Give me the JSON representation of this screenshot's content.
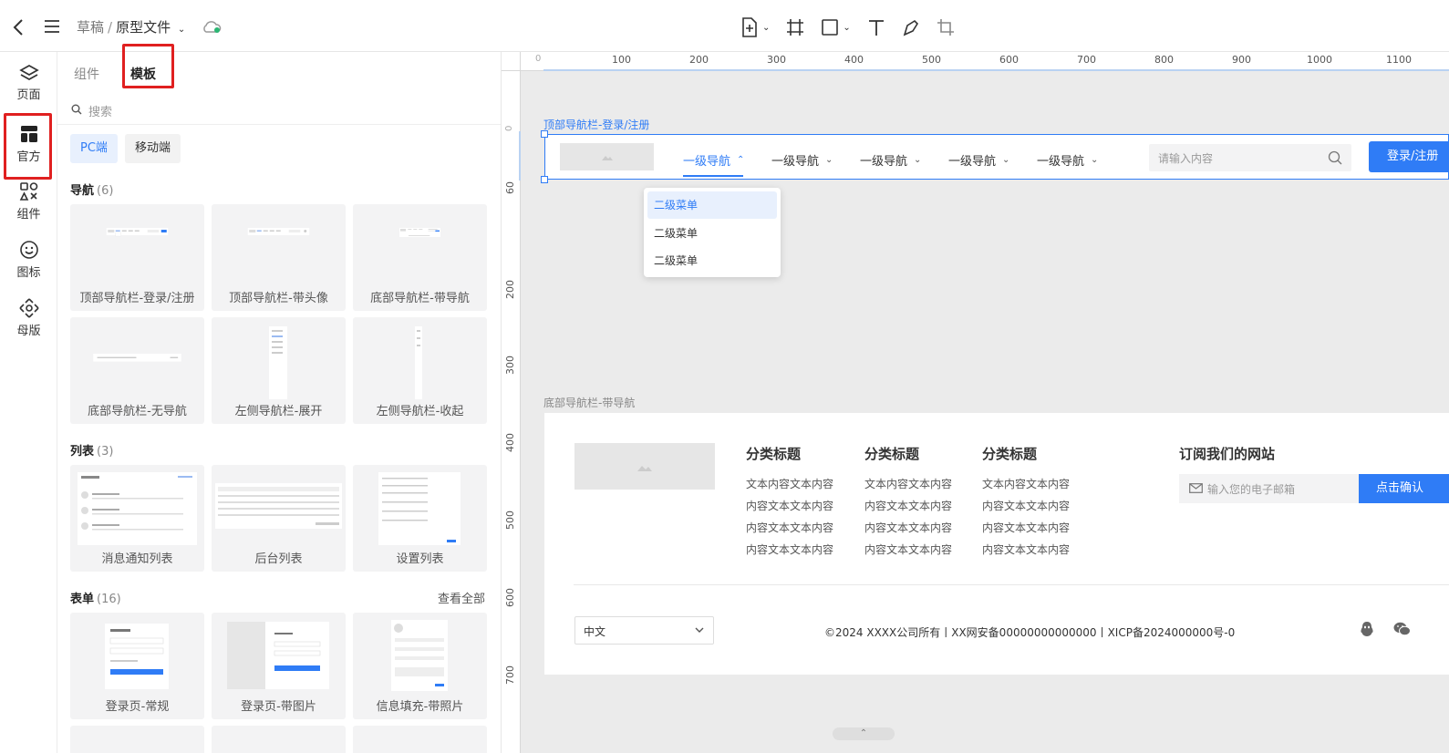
{
  "header": {
    "breadcrumb_root": "草稿",
    "breadcrumb_sep": "/",
    "breadcrumb_current": "原型文件"
  },
  "sidebar": {
    "items": [
      {
        "label": "页面",
        "icon": "layers-icon"
      },
      {
        "label": "官方",
        "icon": "template-icon"
      },
      {
        "label": "组件",
        "icon": "components-icon"
      },
      {
        "label": "图标",
        "icon": "smile-icon"
      },
      {
        "label": "母版",
        "icon": "master-icon"
      }
    ]
  },
  "panel": {
    "tabs": [
      "组件",
      "模板"
    ],
    "search_placeholder": "搜索",
    "segments": [
      "PC端",
      "移动端"
    ],
    "sections": [
      {
        "title": "导航",
        "count": "(6)",
        "cards": [
          "顶部导航栏-登录/注册",
          "顶部导航栏-带头像",
          "底部导航栏-带导航",
          "底部导航栏-无导航",
          "左侧导航栏-展开",
          "左侧导航栏-收起"
        ]
      },
      {
        "title": "列表",
        "count": "(3)",
        "cards": [
          "消息通知列表",
          "后台列表",
          "设置列表"
        ]
      },
      {
        "title": "表单",
        "count": "(16)",
        "view_all": "查看全部",
        "cards": [
          "登录页-常规",
          "登录页-带图片",
          "信息填充-带照片"
        ]
      }
    ]
  },
  "canvas": {
    "ruler_h": [
      "0",
      "100",
      "200",
      "300",
      "400",
      "500",
      "600",
      "700",
      "800",
      "900",
      "1000",
      "1100"
    ],
    "ruler_v": [
      "0",
      "60",
      "200",
      "300",
      "400",
      "500",
      "600",
      "700"
    ],
    "frame1": {
      "label": "顶部导航栏-登录/注册",
      "nav_items": [
        "一级导航",
        "一级导航",
        "一级导航",
        "一级导航",
        "一级导航"
      ],
      "search_placeholder": "请输入内容",
      "button": "登录/注册",
      "dropdown": [
        "二级菜单",
        "二级菜单",
        "二级菜单"
      ]
    },
    "frame2": {
      "label": "底部导航栏-带导航",
      "columns": [
        {
          "title": "分类标题",
          "lines": [
            "文本内容文本内容",
            "内容文本文本内容",
            "内容文本文本内容",
            "内容文本文本内容"
          ]
        },
        {
          "title": "分类标题",
          "lines": [
            "文本内容文本内容",
            "内容文本文本内容",
            "内容文本文本内容",
            "内容文本文本内容"
          ]
        },
        {
          "title": "分类标题",
          "lines": [
            "文本内容文本内容",
            "内容文本文本内容",
            "内容文本文本内容",
            "内容文本文本内容"
          ]
        }
      ],
      "subscribe_title": "订阅我们的网站",
      "email_placeholder": "输入您的电子邮箱",
      "confirm": "点击确认",
      "language": "中文",
      "copyright": "©2024 XXXX公司所有丨XX网安备00000000000000丨XICP备2024000000号-0"
    }
  },
  "colors": {
    "accent": "#2f7cf6",
    "highlight_box": "#e02020",
    "canvas_bg": "#ebebeb"
  }
}
